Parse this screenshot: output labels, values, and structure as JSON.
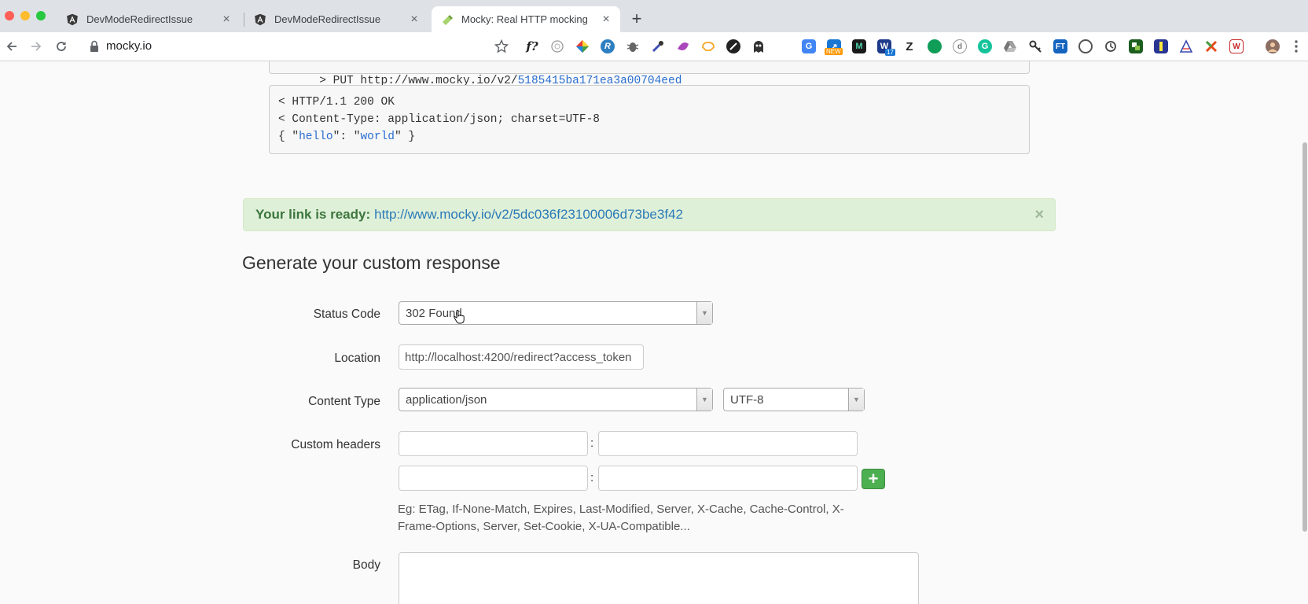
{
  "browser": {
    "tabs": [
      {
        "title": "DevModeRedirectIssue",
        "icon": "angular-icon"
      },
      {
        "title": "DevModeRedirectIssue",
        "icon": "angular-icon"
      },
      {
        "title": "Mocky: Real HTTP mocking",
        "icon": "mocky-icon"
      }
    ],
    "url": "mocky.io",
    "extension_badge_new": "NEW",
    "extension_badge_count": "17",
    "extension_letters": {
      "f": "f?",
      "m": "M",
      "z": "Z",
      "ft": "FT",
      "w": "W"
    }
  },
  "response_preview": {
    "request_line": "> PUT http://www.mocky.io/v2/",
    "request_hash": "5185415ba171ea3a00704eed",
    "status_line": "< HTTP/1.1 200 OK",
    "content_type_line": "< Content-Type: application/json; charset=UTF-8",
    "body_open": "{ \"",
    "body_key": "hello",
    "body_mid": "\": \"",
    "body_value": "world",
    "body_close": "\" }"
  },
  "alert": {
    "label": "Your link is ready:",
    "link": "http://www.mocky.io/v2/5dc036f23100006d73be3f42",
    "close": "×"
  },
  "form": {
    "heading": "Generate your custom response",
    "status_code_label": "Status Code",
    "status_code_value": "302 Found",
    "location_label": "Location",
    "location_value": "http://localhost:4200/redirect?access_token",
    "content_type_label": "Content Type",
    "content_type_value": "application/json",
    "charset_value": "UTF-8",
    "custom_headers_label": "Custom headers",
    "header_separator": ":",
    "add_header": "+",
    "headers_hint": "Eg: ETag, If-None-Match, Expires, Last-Modified, Server, X-Cache, Cache-Control, X-Frame-Options, Server, Set-Cookie, X-UA-Compatible...",
    "body_label": "Body"
  },
  "colors": {
    "alert_bg": "#dff0d8",
    "alert_text": "#3c763d",
    "link": "#2a7ab8",
    "add_button": "#4caf50"
  }
}
